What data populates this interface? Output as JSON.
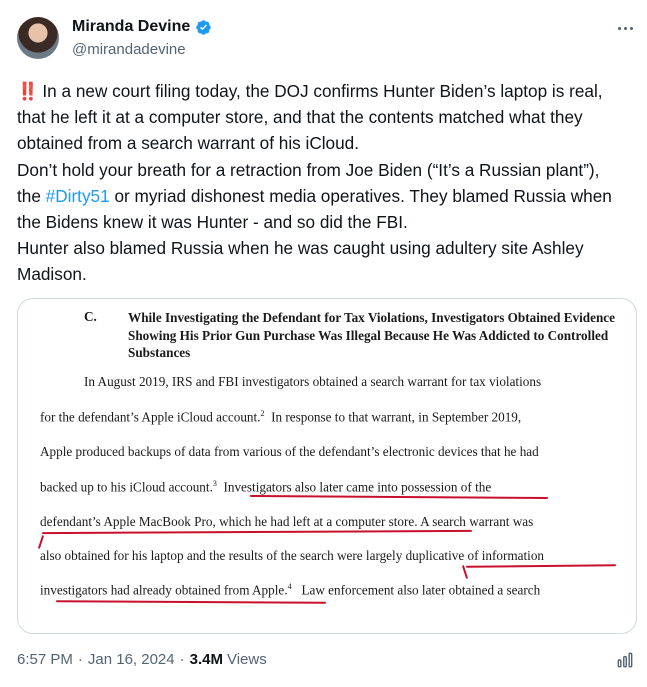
{
  "author": {
    "name": "Miranda Devine",
    "handle": "@mirandadevine"
  },
  "icons": {
    "verified": "verified-badge-icon",
    "more": "more-options-icon",
    "analytics": "analytics-icon"
  },
  "tweet": {
    "emoji": "‼️",
    "line1": "In a new court filing today, the DOJ confirms Hunter Biden’s laptop is real, that he left it at a computer store, and that the contents matched what they obtained from a search warrant of his iCloud.",
    "line2_before": "Don’t hold your breath for a retraction from Joe Biden (“It’s a Russian plant”), the ",
    "hashtag": "#Dirty51",
    "line2_after": " or myriad dishonest media operatives. They blamed Russia when the Bidens knew it was Hunter - and so did the FBI.",
    "line3": "Hunter also blamed Russia when he was caught using adultery site Ashley Madison."
  },
  "document": {
    "section_letter": "C.",
    "section_title": "While Investigating the Defendant for Tax Violations, Investigators Obtained Evidence Showing His Prior Gun Purchase Was Illegal Because He Was Addicted to Controlled Substances",
    "l1": "In August 2019, IRS and FBI investigators obtained a search warrant for tax violations",
    "l2a": "for the defendant’s Apple iCloud account.",
    "l2b": "In response to that warrant, in September 2019,",
    "l3": "Apple produced backups of data from various of the defendant’s electronic devices that he had",
    "l4a": "backed up to his iCloud account.",
    "l4b": "Investigators also later came into possession of the",
    "l5": "defendant’s Apple MacBook Pro, which he had left at a computer store.  A search warrant was",
    "l6": "also obtained for his laptop and the results of the search were largely duplicative of information",
    "l7a": "investigators had already obtained from Apple.",
    "l7b": "Law enforcement also later obtained a search",
    "fn2": "2",
    "fn3": "3",
    "fn4": "4",
    "underline_color": "#c8102e"
  },
  "footer": {
    "time": "6:57 PM",
    "date": "Jan 16, 2024",
    "separator": "·",
    "views_count": "3.4M",
    "views_label": "Views"
  }
}
